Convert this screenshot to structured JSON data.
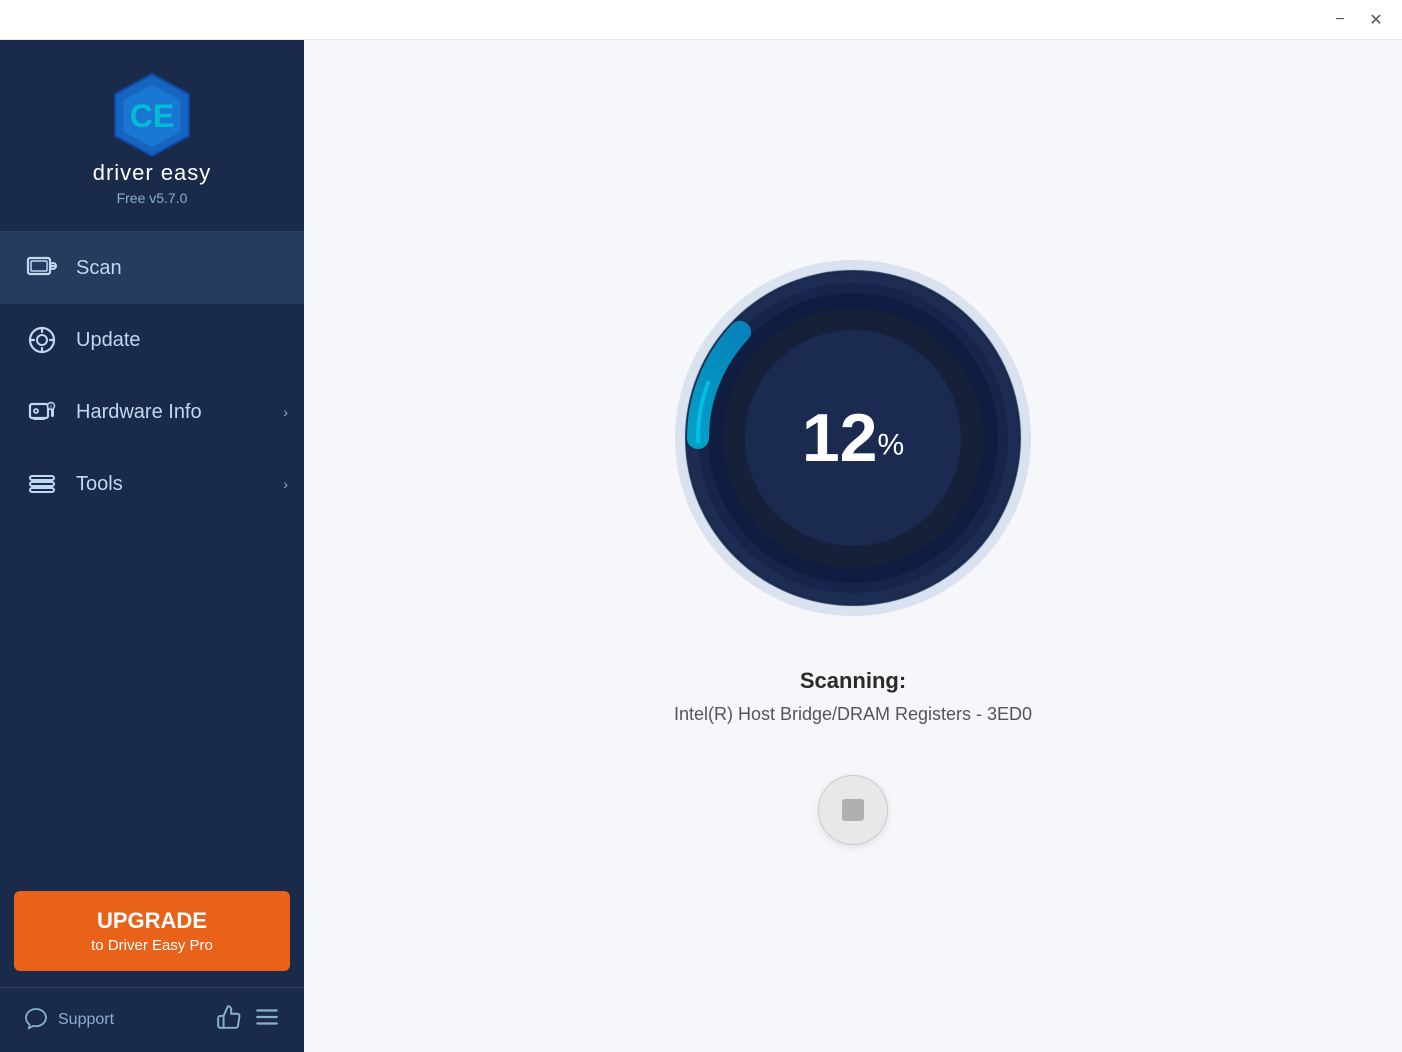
{
  "titlebar": {
    "minimize_label": "−",
    "close_label": "✕"
  },
  "sidebar": {
    "logo": {
      "app_name": "driver easy",
      "version": "Free v5.7.0"
    },
    "nav_items": [
      {
        "id": "scan",
        "label": "Scan",
        "icon": "scan-icon",
        "active": true,
        "has_chevron": false
      },
      {
        "id": "update",
        "label": "Update",
        "icon": "update-icon",
        "active": false,
        "has_chevron": false
      },
      {
        "id": "hardware-info",
        "label": "Hardware Info",
        "icon": "hardware-icon",
        "active": false,
        "has_chevron": true
      },
      {
        "id": "tools",
        "label": "Tools",
        "icon": "tools-icon",
        "active": false,
        "has_chevron": true
      }
    ],
    "upgrade_button": {
      "line1": "UPGRADE",
      "line2": "to Driver Easy Pro"
    },
    "footer": {
      "support_label": "Support",
      "support_icon": "chat-icon",
      "like_icon": "thumbs-up-icon",
      "menu_icon": "menu-icon"
    }
  },
  "main": {
    "scan_progress": 12,
    "scan_percent_sign": "%",
    "scanning_label": "Scanning:",
    "scanning_device": "Intel(R) Host Bridge/DRAM Registers - 3ED0",
    "stop_button_label": "Stop"
  }
}
